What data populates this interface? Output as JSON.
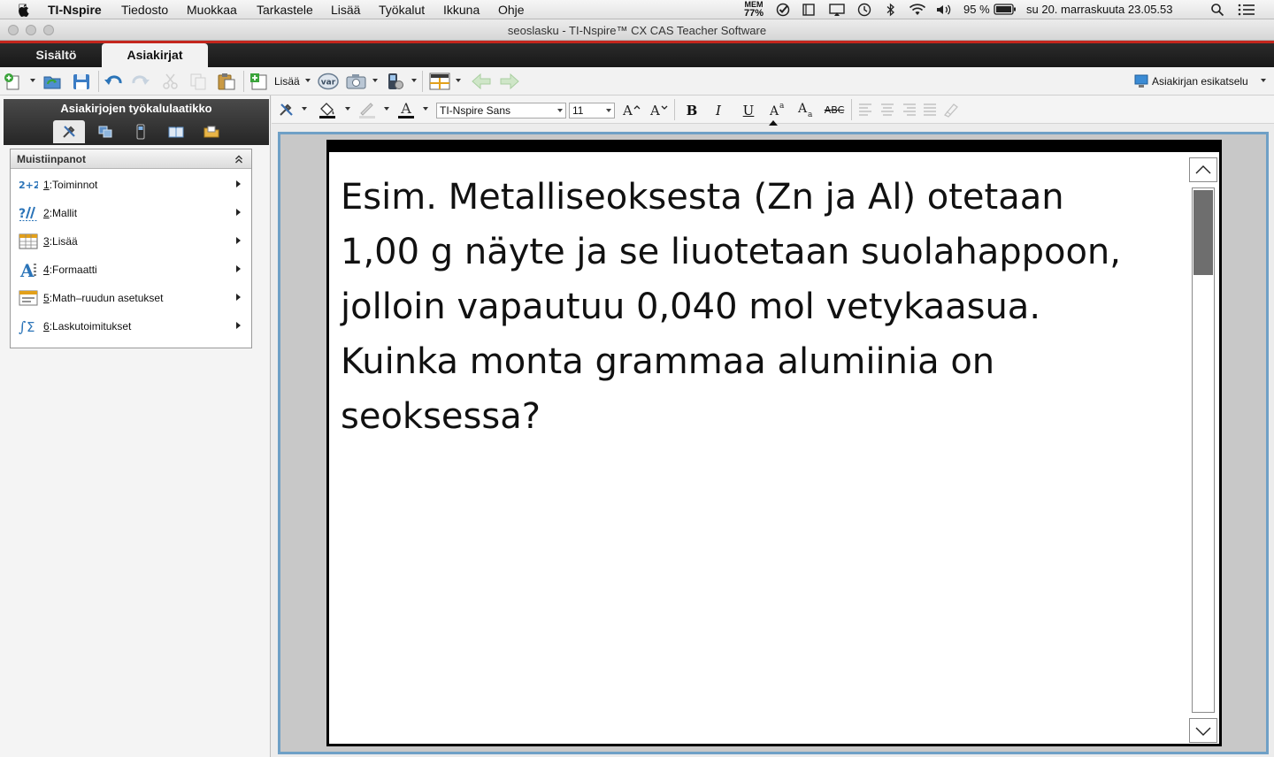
{
  "menubar": {
    "app_name": "TI-Nspire",
    "items": [
      "Tiedosto",
      "Muokkaa",
      "Tarkastele",
      "Lisää",
      "Työkalut",
      "Ikkuna",
      "Ohje"
    ],
    "mem_label": "MEM",
    "mem_value": "77%",
    "battery": "95 %",
    "clock": "su 20. marraskuuta  23.05.53"
  },
  "window": {
    "title": "seoslasku - TI-Nspire™ CX CAS Teacher Software"
  },
  "tabs": [
    {
      "label": "Sisältö"
    },
    {
      "label": "Asiakirjat"
    }
  ],
  "toolbar": {
    "insert_label": "Lisää",
    "var_label": "var",
    "preview_label": "Asiakirjan esikatselu"
  },
  "left_panel": {
    "title": "Asiakirjojen työkalulaatikko",
    "section_title": "Muistiinpanot",
    "items": [
      {
        "num": "1",
        "label": ":Toiminnot",
        "icon": "operations-icon"
      },
      {
        "num": "2",
        "label": ":Mallit",
        "icon": "templates-icon"
      },
      {
        "num": "3",
        "label": ":Lisää",
        "icon": "insert-icon"
      },
      {
        "num": "4",
        "label": ":Formaatti",
        "icon": "format-icon"
      },
      {
        "num": "5",
        "label": ":Math–ruudun asetukset",
        "icon": "math-box-icon"
      },
      {
        "num": "6",
        "label": ":Laskutoimitukset",
        "icon": "calculations-icon"
      }
    ]
  },
  "format_toolbar": {
    "font_name": "TI-Nspire Sans",
    "font_size": "11",
    "bold": "B",
    "italic": "I",
    "underline": "U",
    "strike": "ABC"
  },
  "document": {
    "text": "Esim. Metalliseoksesta (Zn ja Al) otetaan\n1,00 g näyte ja se liuotetaan suolahappoon,\njolloin vapautuu 0,040 mol vetykaasua.\nKuinka monta grammaa alumiinia on\nseoksessa?"
  },
  "colors": {
    "accent_red": "#c4261d",
    "frame_blue": "#6fa0c6",
    "icon_blue": "#2b74b8",
    "icon_green": "#3aa33a"
  }
}
